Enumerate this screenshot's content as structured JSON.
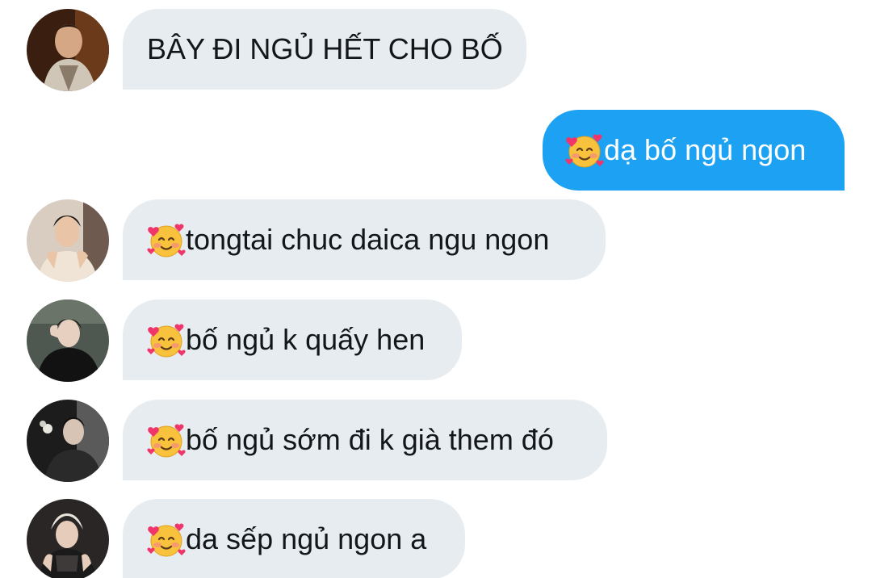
{
  "messages": [
    {
      "sender": "avatar-1",
      "text": "BÂY ĐI NGỦ HẾT CHO BỐ",
      "emoji": ""
    },
    {
      "sender": "me",
      "text": "dạ bố ngủ ngon",
      "emoji": "smiling-face-with-hearts"
    },
    {
      "sender": "avatar-2",
      "text": "tongtai chuc daica ngu ngon",
      "emoji": "smiling-face-with-hearts"
    },
    {
      "sender": "avatar-3",
      "text": "bố ngủ k quấy hen",
      "emoji": "smiling-face-with-hearts"
    },
    {
      "sender": "avatar-4",
      "text": "bố ngủ sớm đi k già them đó",
      "emoji": "smiling-face-with-hearts"
    },
    {
      "sender": "avatar-5",
      "text": "da sếp ngủ ngon a",
      "emoji": "smiling-face-with-hearts"
    }
  ],
  "colors": {
    "incoming_bubble": "#e6ecf0",
    "outgoing_bubble": "#1da1f2",
    "incoming_text": "#14171a",
    "outgoing_text": "#ffffff"
  }
}
